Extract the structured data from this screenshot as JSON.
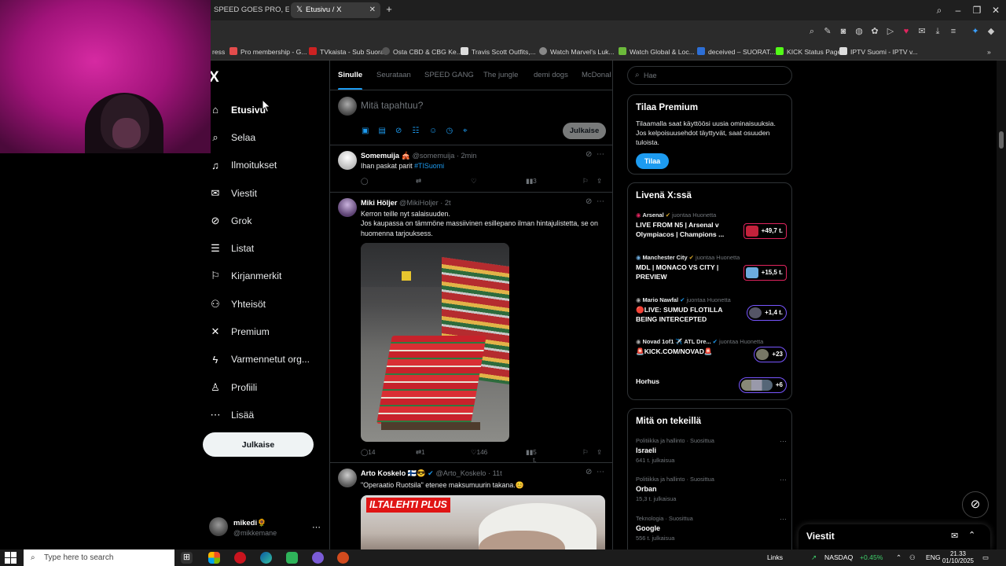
{
  "browser": {
    "tabs": [
      {
        "title": "SPEED GOES PRO, EPISOD",
        "active": false
      },
      {
        "title": "Etusivu / X",
        "active": true
      }
    ],
    "bookmarks": [
      "ress",
      "Pro membership - G...",
      "TVkaista - Sub Suora",
      "Osta CBD & CBG Ke...",
      "Travis Scott Outfits,...",
      "Watch Marvel's Luk...",
      "Watch Global & Loc...",
      "deceived – SUORAT...",
      "KICK Status Page",
      "IPTV Suomi - IPTV v..."
    ]
  },
  "sidebar": {
    "logo": "X",
    "items": [
      {
        "label": "Etusivu",
        "icon": "home-icon",
        "active": true
      },
      {
        "label": "Selaa",
        "icon": "search-icon"
      },
      {
        "label": "Ilmoitukset",
        "icon": "bell-icon"
      },
      {
        "label": "Viestit",
        "icon": "mail-icon"
      },
      {
        "label": "Grok",
        "icon": "grok-icon"
      },
      {
        "label": "Listat",
        "icon": "list-icon"
      },
      {
        "label": "Kirjanmerkit",
        "icon": "bookmark-icon"
      },
      {
        "label": "Yhteisöt",
        "icon": "people-icon"
      },
      {
        "label": "Premium",
        "icon": "x-icon"
      },
      {
        "label": "Varmennetut org...",
        "icon": "lightning-icon"
      },
      {
        "label": "Profiili",
        "icon": "person-icon"
      },
      {
        "label": "Lisää",
        "icon": "more-circle-icon"
      }
    ],
    "post_button": "Julkaise",
    "account": {
      "name": "mikedi🌻",
      "handle": "@mikkemane"
    }
  },
  "feed": {
    "tabs": [
      "Sinulle",
      "Seurataan",
      "SPEED GANG",
      "The jungle",
      "demi dogs",
      "McDonal"
    ],
    "composer": {
      "placeholder": "Mitä tapahtuu?",
      "button": "Julkaise"
    },
    "tweets": [
      {
        "name": "Somemuija 🎪",
        "handle": "@somemuija · 2min",
        "text": "Ihan paskat parit ",
        "hashtag": "#TISuomi",
        "replies": "",
        "retweets": "",
        "likes": "",
        "views": "3"
      },
      {
        "name": "Miki Höljer",
        "handle": "@MikiHoljer · 2t",
        "text": "Kerron teille nyt salaisuuden.\nJos kaupassa on tämmöne massiivinen esillepano ilman hintajulistetta, se on huomenna tarjouksess.",
        "replies": "14",
        "retweets": "1",
        "likes": "146",
        "views": "5 t."
      },
      {
        "name": "Arto Koskelo 🇫🇮😎",
        "handle": "@Arto_Koskelo · 11t",
        "text": "\"Operaatio Ruotsila\" etenee maksumuurin takana.😊",
        "badge": "ILTALEHTI PLUS"
      }
    ]
  },
  "right": {
    "search_placeholder": "Hae",
    "premium": {
      "title": "Tilaa Premium",
      "desc": "Tilaamalla saat käyttöösi uusia ominaisuuksia. Jos kelpoisuusehdot täyttyvät, saat osuuden tuloista.",
      "button": "Tilaa"
    },
    "live": {
      "title": "Livenä X:ssä",
      "items": [
        {
          "host": "Arsenal",
          "suffix": "juontaa Huonetta",
          "title": "LIVE FROM N5 | Arsenal v Olympiacos | Champions ...",
          "count": "+49,7 t."
        },
        {
          "host": "Manchester City",
          "suffix": "juontaa Huonetta",
          "title": "MDL | MONACO VS CITY | PREVIEW",
          "count": "+15,5 t."
        },
        {
          "host": "Mario Nawfal",
          "suffix": "juontaa Huonetta",
          "title": "🔴LIVE: SUMUD FLOTILLA BEING INTERCEPTED",
          "count": "+1,4 t."
        },
        {
          "host": "Novad 1of1 ✈️ ATL Dre...",
          "suffix": "juontaa Huonetta",
          "title": "🚨KICK.COM/NOVAD🚨",
          "count": "+23"
        },
        {
          "host": "",
          "suffix": "",
          "title": "Horhus",
          "count": "+6"
        }
      ]
    },
    "trends": {
      "title": "Mitä on tekeillä",
      "items": [
        {
          "category": "Politiikka ja hallinto · Suosittua",
          "name": "Israeli",
          "count": "641 t. julkaisua"
        },
        {
          "category": "Politiikka ja hallinto · Suosittua",
          "name": "Orban",
          "count": "15,3 t. julkaisua"
        },
        {
          "category": "Teknologia · Suosittua",
          "name": "Google",
          "count": "556 t. julkaisua"
        }
      ]
    },
    "messages_drawer": "Viestit"
  },
  "taskbar": {
    "search_placeholder": "Type here to search",
    "links": "Links",
    "stock": "NASDAQ",
    "stock_change": "+0.45%",
    "lang": "ENG",
    "time": "21.33",
    "date": "01/10/2025"
  },
  "colors": {
    "accent": "#1d9bf0",
    "background": "#000000",
    "border": "#2f3336",
    "muted": "#71767b",
    "positive": "#3fcf6b"
  }
}
